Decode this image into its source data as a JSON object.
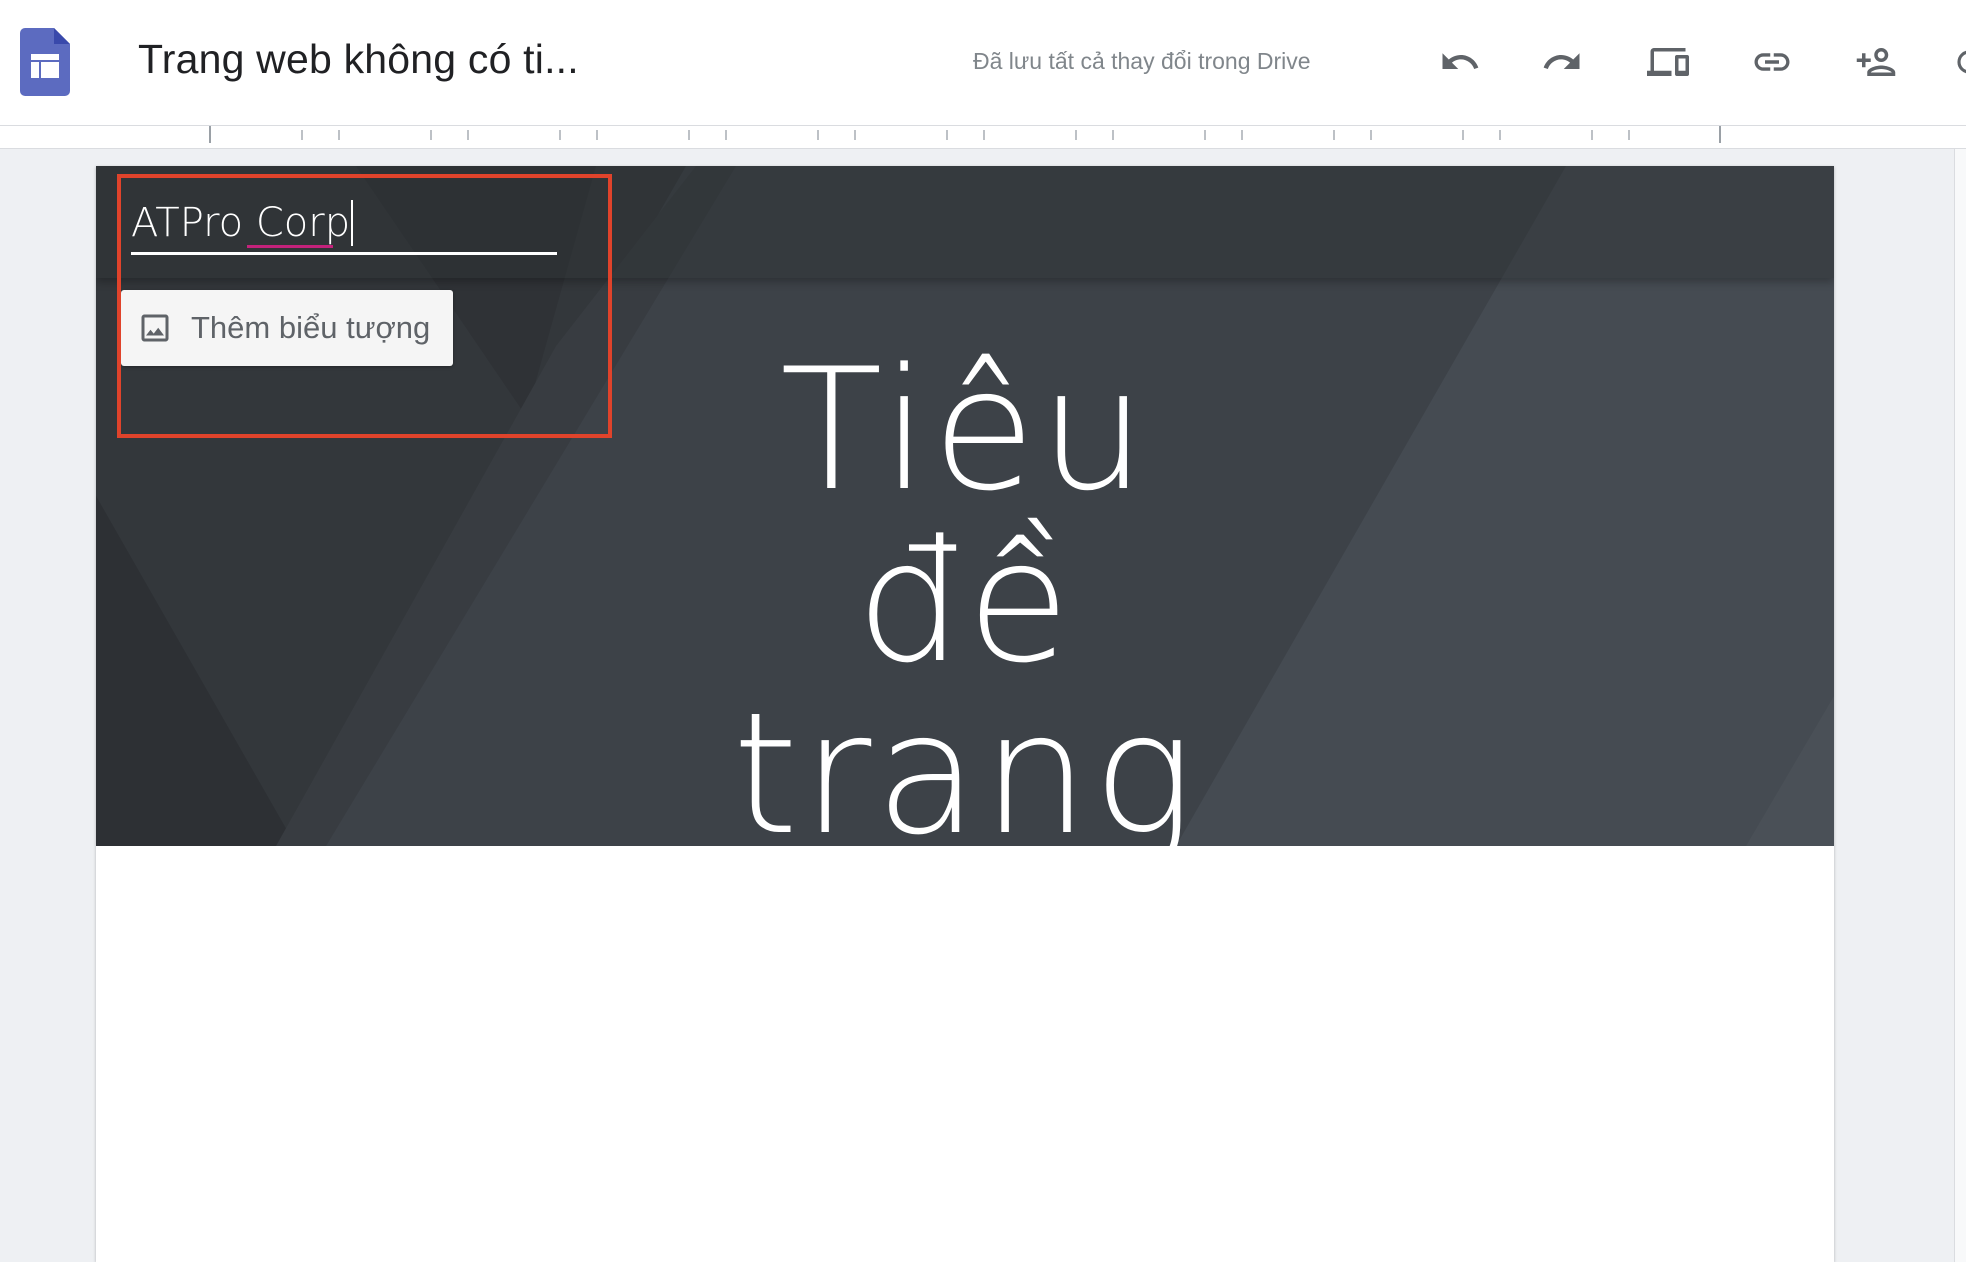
{
  "app": {
    "document_title": "Trang web không có ti...",
    "save_status": "Đã lưu tất cả thay đổi trong Drive",
    "brand_color": "#5c6bc0"
  },
  "toolbar": {
    "undo_icon": "undo-icon",
    "redo_icon": "redo-icon",
    "preview_icon": "devices-preview-icon",
    "link_icon": "link-icon",
    "share_icon": "add-person-icon"
  },
  "site": {
    "site_name": "ATPro Corp",
    "add_logo_label": "Thêm biểu tượng",
    "page_title": "Tiêu đề trang",
    "hero_color": "#3b4045"
  },
  "annotation": {
    "highlight_color": "#e0432b"
  }
}
